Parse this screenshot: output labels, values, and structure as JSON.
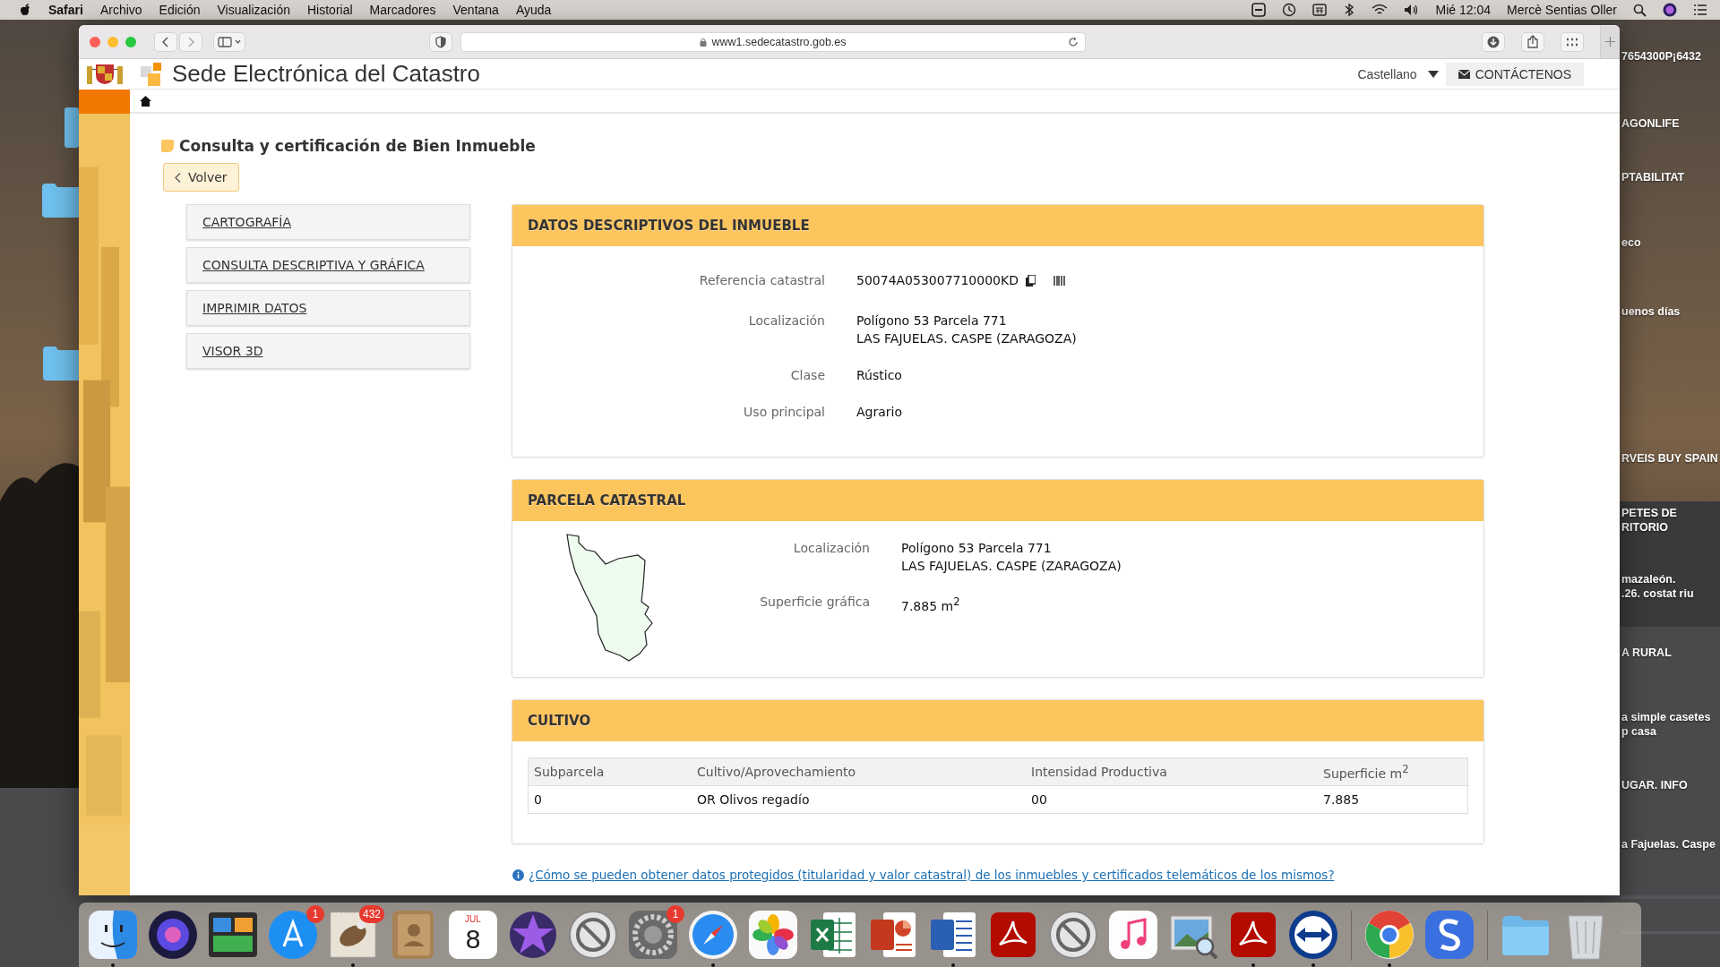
{
  "menu_bar": {
    "app": "Safari",
    "menus": [
      "Archivo",
      "Edición",
      "Visualización",
      "Historial",
      "Marcadores",
      "Ventana",
      "Ayuda"
    ],
    "clock": "Mié 12:04",
    "user": "Mercè Sentias Oller"
  },
  "browser": {
    "address": "www1.sedecatastro.gob.es"
  },
  "site_header": {
    "title": "Sede Electrónica del Catastro",
    "language": "Castellano",
    "contact_button": "CONTÁCTENOS"
  },
  "page_title": "Consulta y certificación de Bien Inmueble",
  "back_button": "Volver",
  "side_menu": [
    "CARTOGRAFÍA",
    "CONSULTA DESCRIPTIVA Y GRÁFICA",
    "IMPRIMIR DATOS",
    "VISOR 3D"
  ],
  "descriptive_data": {
    "title": "DATOS DESCRIPTIVOS DEL INMUEBLE",
    "fields": [
      {
        "label": "Referencia catastral",
        "kind": "reference",
        "lines": [
          "50074A053007710000KD"
        ]
      },
      {
        "label": "Localización",
        "kind": "text",
        "lines": [
          "Polígono 53 Parcela 771",
          "LAS FAJUELAS. CASPE (ZARAGOZA)"
        ]
      },
      {
        "label": "Clase",
        "kind": "text",
        "lines": [
          "Rústico"
        ]
      },
      {
        "label": "Uso principal",
        "kind": "text",
        "lines": [
          "Agrario"
        ]
      }
    ]
  },
  "parcel": {
    "title": "PARCELA CATASTRAL",
    "fields": [
      {
        "label": "Localización",
        "lines": [
          "Polígono 53 Parcela 771",
          "LAS FAJUELAS. CASPE (ZARAGOZA)"
        ]
      },
      {
        "label": "Superficie gráfica",
        "lines": [
          "7.885 m$^{2}$"
        ]
      }
    ]
  },
  "cultivation": {
    "title": "CULTIVO",
    "columns": [
      "Subparcela",
      "Cultivo/Aprovechamiento",
      "Intensidad Productiva",
      "Superficie m$^{2}$"
    ],
    "rows": [
      [
        "0",
        "OR Olivos regadío",
        "00",
        "7.885"
      ]
    ]
  },
  "info_link": "¿Cómo se pueden obtener datos protegidos (titularidad y valor catastral) de los inmuebles y certificados telemáticos de los mismos?",
  "desktop_labels": [
    "7654300P¡6432",
    "AGONLIFE",
    "PTABILITAT",
    "eco",
    "uenos días",
    "RVEIS BUY SPAIN",
    "PETES DE\nRITORIO",
    "mazaleón.\n.26. costat riu",
    "A RURAL",
    "a simple casetes\np casa",
    "UGAR. INFO",
    "a Fajuelas. Caspe"
  ],
  "dock": {
    "apps": [
      {
        "kind": "app",
        "running": true
      },
      {
        "kind": "app",
        "running": false
      },
      {
        "kind": "app",
        "running": false
      },
      {
        "kind": "app",
        "running": false,
        "badge": "1"
      },
      {
        "kind": "app",
        "running": true,
        "badge": "432"
      },
      {
        "kind": "app",
        "running": false
      },
      {
        "kind": "calendar",
        "running": false,
        "month": "JUL",
        "day": "8"
      },
      {
        "kind": "app",
        "running": false
      },
      {
        "kind": "app",
        "running": false
      },
      {
        "kind": "app",
        "running": false,
        "badge": "1"
      },
      {
        "kind": "app",
        "running": true
      },
      {
        "kind": "app",
        "running": false
      },
      {
        "kind": "app",
        "running": false
      },
      {
        "kind": "app",
        "running": false
      },
      {
        "kind": "app",
        "running": true
      },
      {
        "kind": "app",
        "running": false
      },
      {
        "kind": "app",
        "running": false
      },
      {
        "kind": "app",
        "running": false
      },
      {
        "kind": "app",
        "running": false
      },
      {
        "kind": "app",
        "running": true
      },
      {
        "kind": "app",
        "running": true
      }
    ],
    "pinned": [
      {
        "kind": "app",
        "running": true
      },
      {
        "kind": "app",
        "running": false
      }
    ],
    "stacks": [
      {
        "kind": "app",
        "running": false
      },
      {
        "kind": "app",
        "running": false
      }
    ]
  }
}
